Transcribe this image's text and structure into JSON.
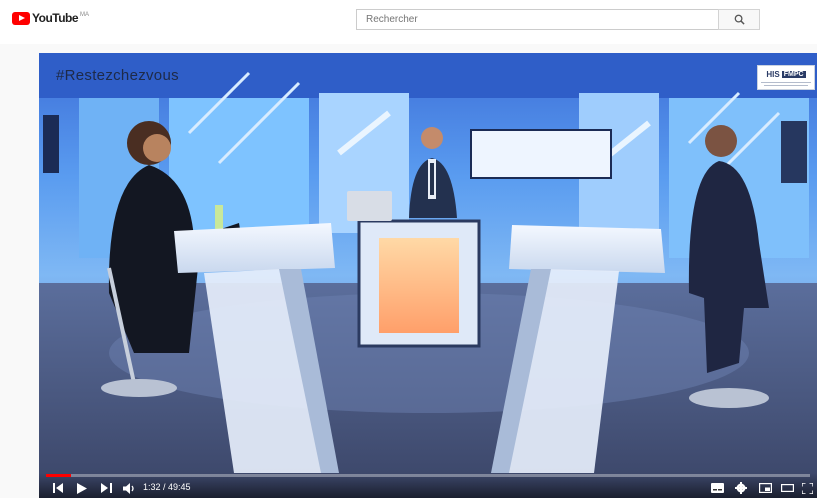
{
  "header": {
    "logo_text": "YouTube",
    "logo_region": "MA",
    "search_placeholder": "Rechercher"
  },
  "video": {
    "overlay_hashtag": "#Restezchezvous",
    "channel_badge": {
      "left": "HIS",
      "right": "FMPC"
    },
    "progress_fraction": 0.0332
  },
  "controls": {
    "time": "1:32 / 49:45"
  },
  "icons": [
    "youtube-logo-icon",
    "search-icon",
    "previous-icon",
    "play-icon",
    "next-icon",
    "volume-icon",
    "subtitles-icon",
    "settings-icon",
    "miniplayer-icon",
    "theater-icon",
    "fullscreen-icon"
  ],
  "colors": {
    "accent": "#ff0000",
    "studio_blue": "#5a9cf0"
  }
}
